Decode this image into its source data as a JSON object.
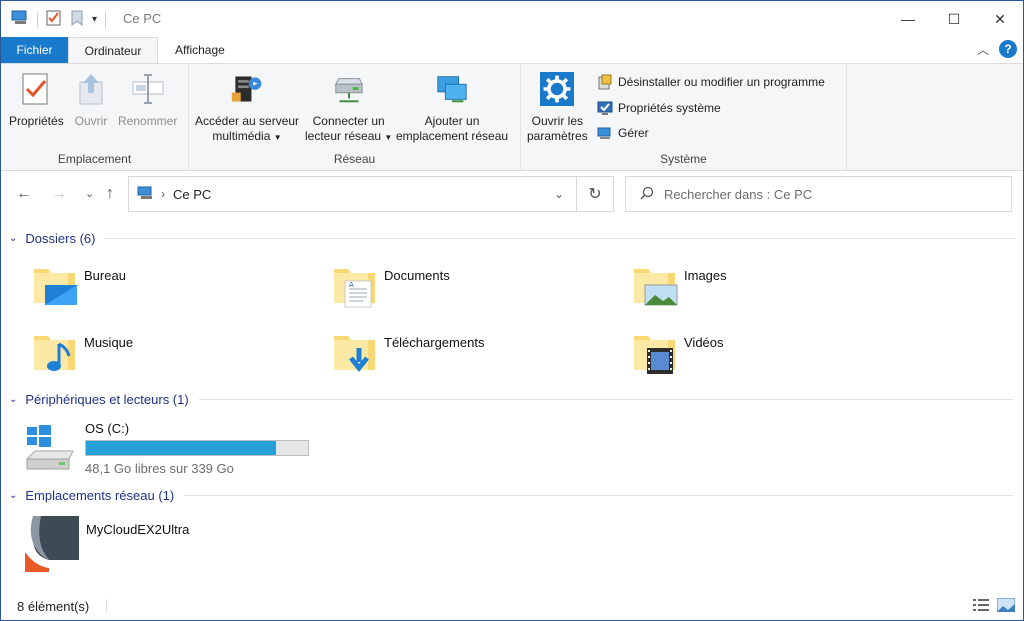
{
  "window": {
    "title": "Ce PC",
    "minimize": "—",
    "maximize": "☐",
    "close": "✕"
  },
  "ribbon_tabs": {
    "file": "Fichier",
    "computer": "Ordinateur",
    "view": "Affichage"
  },
  "ribbon": {
    "location_group": {
      "label": "Emplacement",
      "properties": "Propriétés",
      "open": "Ouvrir",
      "rename": "Renommer"
    },
    "network_group": {
      "label": "Réseau",
      "media_server_l1": "Accéder au serveur",
      "media_server_l2": "multimédia",
      "map_drive_l1": "Connecter un",
      "map_drive_l2": "lecteur réseau",
      "add_location_l1": "Ajouter un",
      "add_location_l2": "emplacement réseau"
    },
    "system_group": {
      "label": "Système",
      "open_settings_l1": "Ouvrir les",
      "open_settings_l2": "paramètres",
      "uninstall": "Désinstaller ou modifier un programme",
      "system_properties": "Propriétés système",
      "manage": "Gérer"
    }
  },
  "navigation": {
    "address_path": "Ce PC",
    "search_placeholder": "Rechercher dans : Ce PC"
  },
  "sections": {
    "folders_header": "Dossiers (6)",
    "devices_header": "Périphériques et lecteurs (1)",
    "network_header": "Emplacements réseau (1)"
  },
  "folders": [
    {
      "name": "Bureau",
      "icon": "desktop-folder-icon"
    },
    {
      "name": "Documents",
      "icon": "documents-folder-icon"
    },
    {
      "name": "Images",
      "icon": "pictures-folder-icon"
    },
    {
      "name": "Musique",
      "icon": "music-folder-icon"
    },
    {
      "name": "Téléchargements",
      "icon": "downloads-folder-icon"
    },
    {
      "name": "Vidéos",
      "icon": "videos-folder-icon"
    }
  ],
  "drives": [
    {
      "name": "OS (C:)",
      "free_text": "48,1 Go libres sur 339 Go",
      "used_fraction": 0.858
    }
  ],
  "network_locations": [
    {
      "name": "MyCloudEX2Ultra"
    }
  ],
  "status": {
    "item_count": "8 élément(s)"
  },
  "colors": {
    "accent": "#1979ca",
    "section_header": "#1e3287",
    "drive_bar": "#26a0da"
  }
}
